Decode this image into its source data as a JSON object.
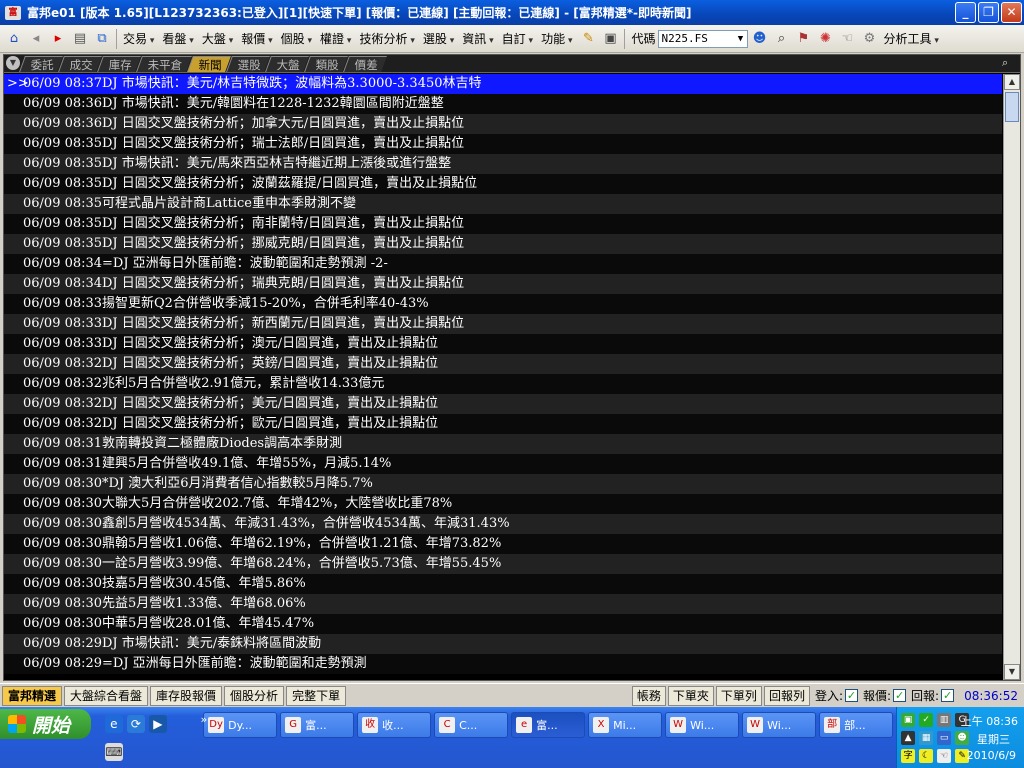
{
  "window": {
    "app_icon": "富",
    "title": "富邦e01 [版本 1.65][L123732363:已登入][1][快速下單] [報價：已連線] [主動回報：已連線] - [富邦精選*-即時新聞]",
    "minimize_icon": "_",
    "restore_icon": "❐",
    "close_icon": "✕"
  },
  "toolbar": {
    "menus": [
      "交易",
      "看盤",
      "大盤",
      "報價",
      "個股",
      "權證",
      "技術分析",
      "選股",
      "資訊",
      "自訂",
      "功能"
    ],
    "code_label": "代碼",
    "code_value": "N225.FS",
    "tools_label": "分析工具"
  },
  "news_panel": {
    "tabs": [
      "委託",
      "成交",
      "庫存",
      "未平倉",
      "新聞",
      "選股",
      "大盤",
      "類股",
      "價差"
    ],
    "active_tab": "新聞",
    "selected_marker": ">>",
    "rows": [
      {
        "dt": "06/09 08:37",
        "text": "DJ 市場快訊：美元/林吉特微跌；波幅料為3.3000-3.3450林吉特"
      },
      {
        "dt": "06/09 08:36",
        "text": "DJ 市場快訊：美元/韓圜料在1228-1232韓圜區間附近盤整"
      },
      {
        "dt": "06/09 08:36",
        "text": "DJ 日圓交叉盤技術分析；加拿大元/日圓買進，賣出及止損點位"
      },
      {
        "dt": "06/09 08:35",
        "text": "DJ 日圓交叉盤技術分析；瑞士法郎/日圓買進，賣出及止損點位"
      },
      {
        "dt": "06/09 08:35",
        "text": "DJ 市場快訊：美元/馬來西亞林吉特繼近期上漲後或進行盤整"
      },
      {
        "dt": "06/09 08:35",
        "text": "DJ 日圓交叉盤技術分析；波蘭茲羅提/日圓買進，賣出及止損點位"
      },
      {
        "dt": "06/09 08:35",
        "text": "可程式晶片設計商Lattice重申本季財測不變"
      },
      {
        "dt": "06/09 08:35",
        "text": "DJ 日圓交叉盤技術分析；南非蘭特/日圓買進，賣出及止損點位"
      },
      {
        "dt": "06/09 08:35",
        "text": "DJ 日圓交叉盤技術分析；挪威克朗/日圓買進，賣出及止損點位"
      },
      {
        "dt": "06/09 08:34",
        "text": "=DJ 亞洲每日外匯前瞻：波動範圍和走勢預測 -2-"
      },
      {
        "dt": "06/09 08:34",
        "text": "DJ 日圓交叉盤技術分析；瑞典克朗/日圓買進，賣出及止損點位"
      },
      {
        "dt": "06/09 08:33",
        "text": "揚智更新Q2合併營收季減15-20%，合併毛利率40-43%"
      },
      {
        "dt": "06/09 08:33",
        "text": "DJ 日圓交叉盤技術分析；新西蘭元/日圓買進，賣出及止損點位"
      },
      {
        "dt": "06/09 08:33",
        "text": "DJ 日圓交叉盤技術分析；澳元/日圓買進，賣出及止損點位"
      },
      {
        "dt": "06/09 08:32",
        "text": "DJ 日圓交叉盤技術分析；英鎊/日圓買進，賣出及止損點位"
      },
      {
        "dt": "06/09 08:32",
        "text": "兆利5月合併營收2.91億元，累計營收14.33億元"
      },
      {
        "dt": "06/09 08:32",
        "text": "DJ 日圓交叉盤技術分析；美元/日圓買進，賣出及止損點位"
      },
      {
        "dt": "06/09 08:32",
        "text": "DJ 日圓交叉盤技術分析；歐元/日圓買進，賣出及止損點位"
      },
      {
        "dt": "06/09 08:31",
        "text": "敦南轉投資二極體廠Diodes調高本季財測"
      },
      {
        "dt": "06/09 08:31",
        "text": "建興5月合併營收49.1億、年增55%，月減5.14%"
      },
      {
        "dt": "06/09 08:30",
        "text": "*DJ 澳大利亞6月消費者信心指數較5月降5.7%"
      },
      {
        "dt": "06/09 08:30",
        "text": "大聯大5月合併營收202.7億、年增42%，大陸營收比重78%"
      },
      {
        "dt": "06/09 08:30",
        "text": "鑫創5月營收4534萬、年減31.43%，合併營收4534萬、年減31.43%"
      },
      {
        "dt": "06/09 08:30",
        "text": "鼎翰5月營收1.06億、年增62.19%，合併營收1.21億、年增73.82%"
      },
      {
        "dt": "06/09 08:30",
        "text": "一詮5月營收3.99億、年增68.24%，合併營收5.73億、年增55.45%"
      },
      {
        "dt": "06/09 08:30",
        "text": "技嘉5月營收30.45億、年增5.86%"
      },
      {
        "dt": "06/09 08:30",
        "text": "先益5月營收1.33億、年增68.06%"
      },
      {
        "dt": "06/09 08:30",
        "text": "中華5月營收28.01億、年增45.47%"
      },
      {
        "dt": "06/09 08:29",
        "text": "DJ 市場快訊：美元/泰銖料將區間波動"
      },
      {
        "dt": "06/09 08:29",
        "text": "=DJ 亞洲每日外匯前瞻：波動範圍和走勢預測"
      }
    ]
  },
  "bottom_bar": {
    "tabs": [
      "富邦精選",
      "大盤綜合看盤",
      "庫存股報價",
      "個股分析",
      "完整下單"
    ],
    "active_tab": "富邦精選",
    "buttons": [
      "帳務",
      "下單夾",
      "下單列",
      "回報列"
    ],
    "checks": [
      {
        "label": "登入:",
        "checked": true
      },
      {
        "label": "報價:",
        "checked": true
      },
      {
        "label": "回報:",
        "checked": true
      }
    ],
    "check_mark": "✓",
    "time": "08:36:52"
  },
  "taskbar": {
    "start_label": "開始",
    "tasks": [
      {
        "icon": "Dy",
        "label": "Dy..."
      },
      {
        "icon": "G",
        "label": "富..."
      },
      {
        "icon": "收",
        "label": "收..."
      },
      {
        "icon": "C",
        "label": "C..."
      },
      {
        "icon": "e",
        "label": "富..."
      },
      {
        "icon": "X",
        "label": "Mi..."
      },
      {
        "icon": "W",
        "label": "Wi..."
      },
      {
        "icon": "W",
        "label": "Wi..."
      },
      {
        "icon": "部",
        "label": "部..."
      }
    ],
    "active_task_index": 4,
    "clock_time": "上午 08:36",
    "clock_weekday": "星期三",
    "clock_date": "2010/6/9"
  },
  "colors": {
    "selected_row": "#1018ff",
    "active_tab": "#c8a030",
    "taskbar": "#245edb",
    "start_button": "#3c9a37"
  }
}
